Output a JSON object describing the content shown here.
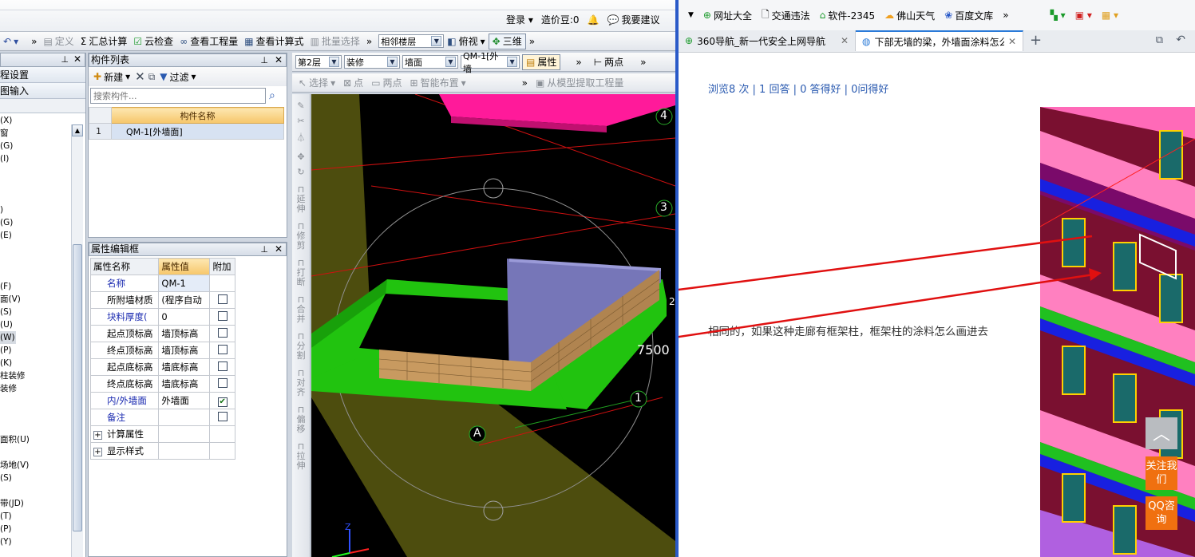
{
  "left_app": {
    "top_bar": {
      "login": "登录",
      "cost_beans": "造价豆:0",
      "suggest": "我要建议"
    },
    "toolbar": {
      "undo": "↶",
      "define": "定义",
      "summary_calc": "汇总计算",
      "cloud_check": "云检查",
      "view_quantity": "查看工程量",
      "view_formula": "查看计算式",
      "batch_select": "批量选择",
      "adjacent_floor": "相邻楼层",
      "top_view": "俯视",
      "three_d": "三维"
    },
    "left_panel": {
      "menu": [
        "程设置",
        "图输入"
      ],
      "tree": [
        "(X)",
        "窗",
        "(G)",
        "(I)",
        "",
        "",
        "",
        ")",
        "(G)",
        "(E)",
        "",
        "",
        "",
        "(F)",
        "面(V)",
        "(S)",
        "(U)",
        "(W)",
        "(P)",
        "(K)",
        "柱装修",
        "装修",
        "",
        "",
        "",
        "面积(U)",
        "",
        "场地(V)",
        "(S)",
        "",
        "带(JD)",
        "(T)",
        "(P)",
        "(Y)"
      ]
    },
    "component_list": {
      "title": "构件列表",
      "new_btn": "新建",
      "filter_btn": "过滤",
      "search_placeholder": "搜索构件...",
      "col_header": "构件名称",
      "rows": [
        {
          "num": "1",
          "name": "QM-1[外墙面]"
        }
      ]
    },
    "property_editor": {
      "title": "属性编辑框",
      "headers": {
        "name": "属性名称",
        "value": "属性值",
        "extra": "附加"
      },
      "rows": [
        {
          "name": "名称",
          "value": "QM-1",
          "checkbox": null
        },
        {
          "name": "所附墙材质",
          "value": "(程序自动",
          "checkbox": false
        },
        {
          "name": "块料厚度(",
          "value": "0",
          "checkbox": false
        },
        {
          "name": "起点顶标高",
          "value": "墙顶标高",
          "checkbox": false
        },
        {
          "name": "终点顶标高",
          "value": "墙顶标高",
          "checkbox": false
        },
        {
          "name": "起点底标高",
          "value": "墙底标高",
          "checkbox": false
        },
        {
          "name": "终点底标高",
          "value": "墙底标高",
          "checkbox": false
        },
        {
          "name": "内/外墙面",
          "value": "外墙面",
          "checkbox": true
        },
        {
          "name": "备注",
          "value": "",
          "checkbox": false
        }
      ],
      "groups": [
        "计算属性",
        "显示样式"
      ]
    },
    "view_toolbar": {
      "floor": "第2层",
      "category": "装修",
      "type": "墙面",
      "component": "QM-1[外墙",
      "properties_btn": "属性",
      "two_points": "两点",
      "select": "选择",
      "point": "点",
      "two_points2": "两点",
      "smart_layout": "智能布置",
      "extract_from_model": "从模型提取工程量"
    },
    "side_tools": [
      "延伸",
      "修剪",
      "打断",
      "合并",
      "分割",
      "对齐",
      "偏移",
      "拉伸"
    ],
    "viewport_labels": {
      "axis_4": "4",
      "axis_3": "3",
      "axis_2": "2",
      "axis_1": "1",
      "axis_a": "A",
      "dim": "7500",
      "z": "Z"
    }
  },
  "browser": {
    "bookmarks": [
      "网址大全",
      "交通违法",
      "软件-2345",
      "佛山天气",
      "百度文库"
    ],
    "tabs": [
      {
        "label": "360导航_新一代安全上网导航",
        "active": false
      },
      {
        "label": "下部无墙的梁，外墙面涂料怎么画",
        "active": true
      }
    ],
    "stats": "浏览8 次 | 1 回答 | 0 答得好 | 0问得好",
    "question_text": "相同的，如果这种走廊有框架柱，框架柱的涂料怎么画进去",
    "side_widgets": {
      "top": "︿",
      "follow": "关注我们",
      "qq": "QQ咨询"
    }
  }
}
